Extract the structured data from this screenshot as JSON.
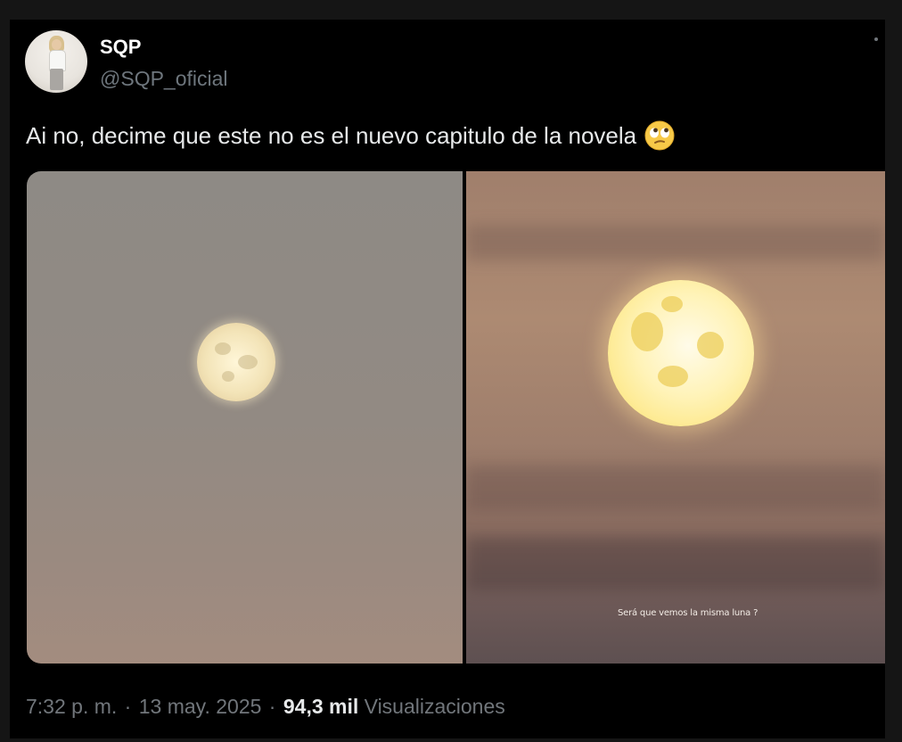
{
  "tweet": {
    "author": {
      "display_name": "SQP",
      "handle": "@SQP_oficial"
    },
    "text": "Ai no, decime que este no es el nuevo capitulo de la novela",
    "emoji": "face-with-rolling-eyes-icon",
    "media": {
      "right_image_caption": "Será que vemos la misma luna ?"
    },
    "meta": {
      "time": "7:32 p. m.",
      "separator": "·",
      "date": "13 may. 2025",
      "views_count": "94,3 mil",
      "views_label": "Visualizaciones"
    }
  },
  "colors": {
    "background": "#000000",
    "outer_background": "#151515",
    "primary_text": "#e7e9ea",
    "secondary_text": "#71767b",
    "emoji_yellow": "#f7c948"
  }
}
